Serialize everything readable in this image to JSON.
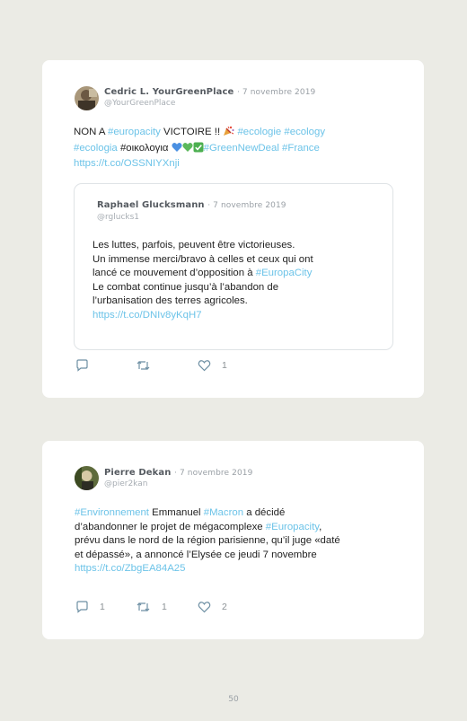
{
  "tweets": [
    {
      "author": "Cedric L. YourGreenPlace",
      "date": "· 7 novembre 2019",
      "handle": "@YourGreenPlace",
      "lines": [
        [
          {
            "t": "NON A ",
            "c": "text"
          },
          {
            "t": "#europacity",
            "c": "link"
          },
          {
            "t": " VICTOIRE !! ",
            "c": "text"
          },
          {
            "t": "party-popper-emoji",
            "c": "emoji"
          },
          {
            "t": " ",
            "c": "text"
          },
          {
            "t": "#ecologie",
            "c": "link"
          },
          {
            "t": " ",
            "c": "text"
          },
          {
            "t": "#ecology",
            "c": "link"
          }
        ],
        [
          {
            "t": "#ecologia",
            "c": "link"
          },
          {
            "t": " #οικολογια ",
            "c": "text"
          },
          {
            "t": "blue-heart-emoji",
            "c": "emoji"
          },
          {
            "t": "green-heart-emoji",
            "c": "emoji"
          },
          {
            "t": "check-mark-emoji",
            "c": "emoji"
          },
          {
            "t": "#GreenNewDeal",
            "c": "link"
          },
          {
            "t": " ",
            "c": "text"
          },
          {
            "t": "#France",
            "c": "link"
          }
        ],
        [
          {
            "t": "https://t.co/OSSNIYXnji",
            "c": "link"
          }
        ]
      ],
      "quote": {
        "author": "Raphael Glucksmann",
        "date": "· 7 novembre 2019",
        "handle": "@rglucks1",
        "lines": [
          [
            {
              "t": "Les luttes, parfois, peuvent être victorieuses.",
              "c": "text"
            }
          ],
          [
            {
              "t": "Un immense merci/bravo à celles et ceux qui ont",
              "c": "text"
            }
          ],
          [
            {
              "t": "lancé ce mouvement d’opposition à ",
              "c": "text"
            },
            {
              "t": "#EuropaCity",
              "c": "link"
            }
          ],
          [
            {
              "t": "Le combat continue jusqu’à l’abandon de",
              "c": "text"
            }
          ],
          [
            {
              "t": "l’urbanisation des terres agricoles.",
              "c": "text"
            }
          ],
          [
            {
              "t": " ",
              "c": "text"
            }
          ],
          [
            {
              "t": "https://t.co/DNIv8yKqH7",
              "c": "link"
            }
          ]
        ]
      },
      "actions": {
        "replies": "",
        "retweets": "",
        "likes": "1"
      }
    },
    {
      "author": "Pierre Dekan",
      "date": "· 7 novembre 2019",
      "handle": "@pier2kan",
      "lines": [
        [
          {
            "t": "#Environnement",
            "c": "link"
          },
          {
            "t": " Emmanuel ",
            "c": "text"
          },
          {
            "t": "#Macron",
            "c": "link"
          },
          {
            "t": " a décidé",
            "c": "text"
          }
        ],
        [
          {
            "t": "d’abandonner le projet de mégacomplexe ",
            "c": "text"
          },
          {
            "t": "#Europacity",
            "c": "link"
          },
          {
            "t": ",",
            "c": "text"
          }
        ],
        [
          {
            "t": "prévu dans le nord de la région parisienne, qu’il juge «daté",
            "c": "text"
          }
        ],
        [
          {
            "t": "et dépassé», a annoncé l’Elysée ce jeudi 7 novembre",
            "c": "text"
          }
        ],
        [
          {
            "t": "https://t.co/ZbgEA84A25",
            "c": "link"
          }
        ]
      ],
      "actions": {
        "replies": "1",
        "retweets": "1",
        "likes": "2"
      }
    }
  ],
  "page_number": "50",
  "colors": {
    "link": "#6cc3e8",
    "background": "#ebebe5",
    "card": "#ffffff"
  }
}
